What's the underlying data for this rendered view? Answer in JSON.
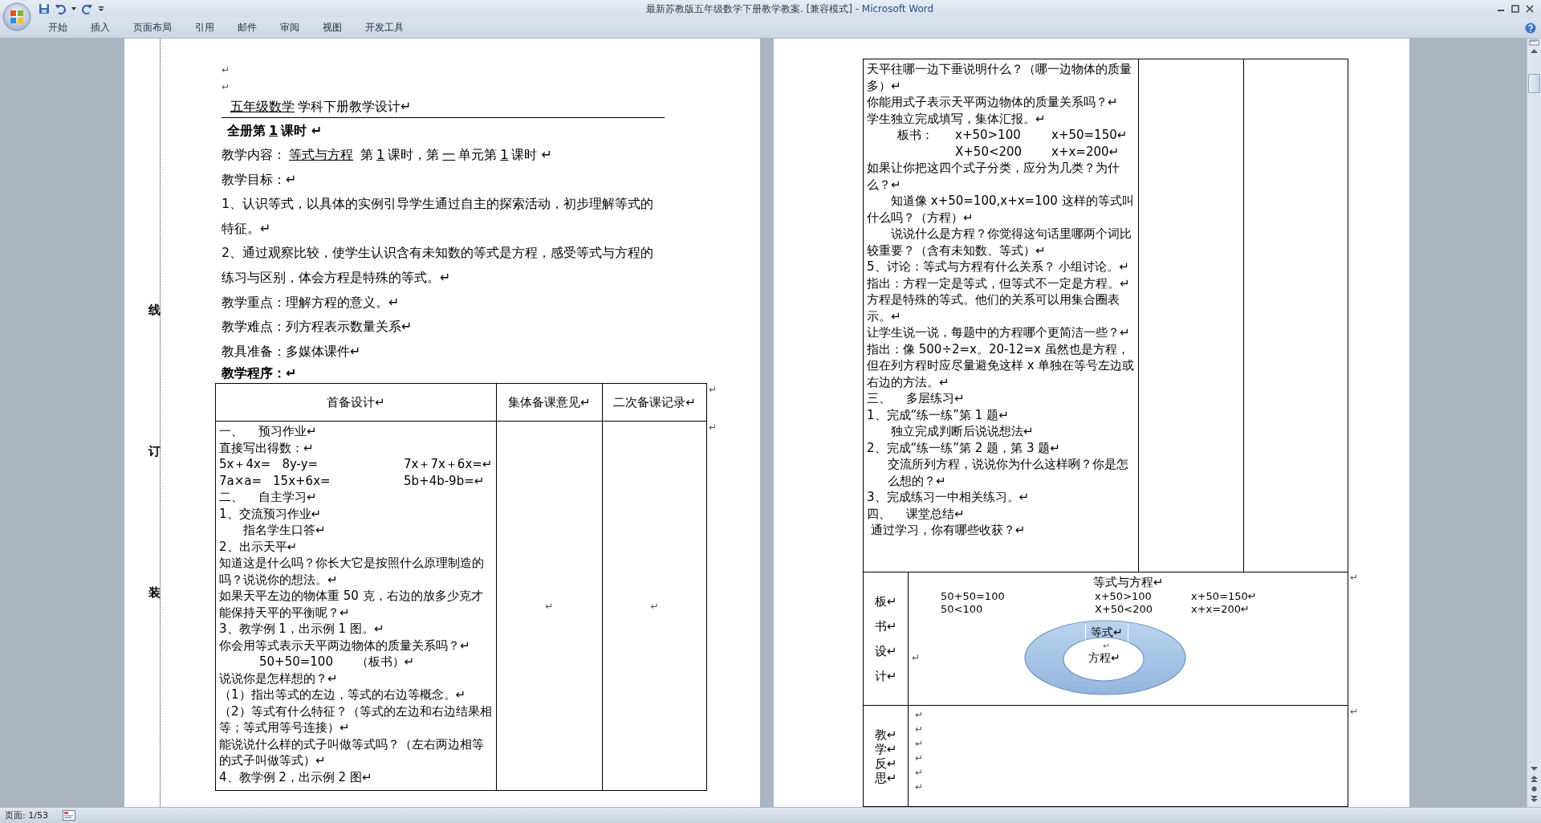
{
  "window": {
    "title": "最新苏教版五年级数学下册教学教案. [兼容模式]",
    "separator": "-",
    "app_name": "Microsoft Word"
  },
  "ribbon_tabs": [
    {
      "label": "开始",
      "selected": false
    },
    {
      "label": "插入",
      "selected": false
    },
    {
      "label": "页面布局",
      "selected": false
    },
    {
      "label": "引用",
      "selected": false
    },
    {
      "label": "邮件",
      "selected": false
    },
    {
      "label": "审阅",
      "selected": false
    },
    {
      "label": "视图",
      "selected": false
    },
    {
      "label": "开发工具",
      "selected": false
    }
  ],
  "left_page": {
    "gutter_marks": [
      "线",
      "订",
      "装"
    ],
    "blank_lines": [
      "↵",
      "↵"
    ],
    "heading": [
      {
        "text": "五年级数学",
        "underlined": true
      },
      {
        "text": "学科下册教学设计↵",
        "underlined": false
      }
    ],
    "lesson": [
      {
        "text": "全册第",
        "underlined": false
      },
      {
        "text": "1",
        "underlined": true
      },
      {
        "text": "课时 ↵",
        "underlined": false
      }
    ],
    "content_line": [
      {
        "text": "教学内容：",
        "underlined": false
      },
      {
        "text": "等式与方程",
        "underlined": true
      },
      {
        "text": " 第",
        "underlined": false
      },
      {
        "text": "1",
        "underlined": true
      },
      {
        "text": "课时，第",
        "underlined": false
      },
      {
        "text": "一",
        "underlined": true
      },
      {
        "text": "单元第",
        "underlined": false
      },
      {
        "text": "1",
        "underlined": true
      },
      {
        "text": "课时 ↵",
        "underlined": false
      }
    ],
    "paragraphs": [
      {
        "text": "教学目标：↵",
        "bold": false
      },
      {
        "text": "1、认识等式，以具体的实例引导学生通过自主的探索活动，初步理解等式的特征。↵",
        "bold": false
      },
      {
        "text": "2、通过观察比较，使学生认识含有未知数的等式是方程，感受等式与方程的练习与区别，体会方程是特殊的等式。↵",
        "bold": false
      },
      {
        "text": "教学重点：理解方程的意义。↵",
        "bold": false
      },
      {
        "text": "教学难点：列方程表示数量关系↵",
        "bold": false
      },
      {
        "text": "教具准备：多媒体课件↵",
        "bold": false
      },
      {
        "text": "教学程序：↵",
        "bold": true
      }
    ],
    "table": {
      "headers": [
        "首备设计↵",
        "集体备课意见↵",
        "二次备课记录↵"
      ],
      "header_end_mark": "↵",
      "lines": [
        {
          "kind": "text",
          "text": "一、    预习作业↵"
        },
        {
          "kind": "text",
          "text": "直接写出得数：↵"
        },
        {
          "kind": "formula",
          "cells": [
            "5x＋4x=",
            "8y-y=",
            "7x＋7x＋6x=↵"
          ]
        },
        {
          "kind": "formula",
          "cells": [
            "7a×a=",
            "15x+6x=",
            "5b+4b-9b=↵"
          ]
        },
        {
          "kind": "text",
          "text": "二、    自主学习↵"
        },
        {
          "kind": "text",
          "text": "1、交流预习作业↵"
        },
        {
          "kind": "first_indent",
          "text": "指名学生口答↵"
        },
        {
          "kind": "text",
          "text": "2、出示天平↵"
        },
        {
          "kind": "text",
          "text": "知道这是什么吗？你长大它是按照什么原理制造的吗？说说你的想法。↵"
        },
        {
          "kind": "text",
          "text": "如果天平左边的物体重 50 克，右边的放多少克才能保持天平的平衡呢？↵"
        },
        {
          "kind": "text",
          "text": "3、教学例 1，出示例 1 图。↵"
        },
        {
          "kind": "text",
          "text": "你会用等式表示天平两边物体的质量关系吗？↵"
        },
        {
          "kind": "deep_indent",
          "text": "50+50=100      （板书）↵"
        },
        {
          "kind": "text",
          "text": "说说你是怎样想的？↵"
        },
        {
          "kind": "text",
          "text": "（1）指出等式的左边，等式的右边等概念。↵"
        },
        {
          "kind": "text",
          "text": "（2）等式有什么特征？（等式的左边和右边结果相等；等式用等号连接）↵"
        },
        {
          "kind": "text",
          "text": "能说说什么样的式子叫做等式吗？（左右两边相等的式子叫做等式）↵"
        },
        {
          "kind": "text",
          "text": "4、教学例 2，出示例 2 图↵"
        }
      ],
      "column_2": "↵",
      "column_3": "↵",
      "body_end_mark": "↵"
    }
  },
  "right_page": {
    "table": {
      "lines": [
        {
          "kind": "text",
          "text": "天平往哪一边下垂说明什么？（哪一边物体的质量多）↵"
        },
        {
          "kind": "text",
          "text": "你能用式子表示天平两边物体的质量关系吗？↵"
        },
        {
          "kind": "text",
          "text": "学生独立完成填写，集体汇报。↵"
        },
        {
          "kind": "board",
          "cells": [
            "板书：",
            "x+50>100",
            "x+50=150↵"
          ]
        },
        {
          "kind": "board",
          "cells": [
            "X+50<200",
            "x+x=200↵"
          ]
        },
        {
          "kind": "text",
          "text": "如果让你把这四个式子分类，应分为几类？为什么？↵"
        },
        {
          "kind": "first_indent",
          "text": "知道像 x+50=100,x+x=100 这样的等式叫什么吗？（方程）↵"
        },
        {
          "kind": "first_indent",
          "text": "说说什么是方程？你觉得这句话里哪两个词比较重要？（含有未知数、等式）↵"
        },
        {
          "kind": "text",
          "text": "5、讨论：等式与方程有什么关系？ 小组讨论。↵"
        },
        {
          "kind": "text",
          "text": "指出：方程一定是等式，但等式不一定是方程。↵"
        },
        {
          "kind": "text",
          "text": "方程是特殊的等式。他们的关系可以用集合圈表示。↵"
        },
        {
          "kind": "text",
          "text": "让学生说一说，每题中的方程哪个更简洁一些？↵"
        },
        {
          "kind": "text",
          "text": "指出：像 500÷2=x。20-12=x 虽然也是方程，但在列方程时应尽量避免这样 x 单独在等号左边或右边的方法。↵"
        },
        {
          "kind": "text",
          "text": "三、    多层练习↵"
        },
        {
          "kind": "text",
          "text": "1、完成“练一练”第 1 题↵"
        },
        {
          "kind": "first_indent",
          "text": "独立完成判断后说说想法↵"
        },
        {
          "kind": "text",
          "text": "2、完成“练一练”第 2 题，第 3 题↵"
        },
        {
          "kind": "hanging",
          "text": "交流所列方程，说说你为什么这样咧？你是怎么想的？↵"
        },
        {
          "kind": "text",
          "text": "3、完成练习一中相关练习。↵"
        },
        {
          "kind": "text",
          "text": "四、    课堂总结↵"
        },
        {
          "kind": "text",
          "text": " 通过学习，你有哪些收获？↵"
        }
      ]
    },
    "board_row": {
      "label": [
        "板↵",
        "书↵",
        "设↵",
        "计↵"
      ],
      "title": "等式与方程↵",
      "formula_columns": [
        [
          "50+50=100",
          "50<100"
        ],
        [
          "x+50>100",
          "X+50<200"
        ],
        [
          "x+50=150↵",
          "x+x=200↵"
        ]
      ],
      "side_mark": "↵",
      "diagram": {
        "outer_label": "等式↵",
        "gap_mark": "↵",
        "inner_label": "方程↵"
      },
      "end_mark": "↵"
    },
    "reflection_row": {
      "label": [
        "教↵",
        "学↵",
        "反↵",
        "思↵"
      ],
      "lines": [
        "↵",
        "↵",
        "↵",
        "↵",
        "↵",
        "↵"
      ],
      "end_mark": "↵"
    }
  },
  "status_bar": {
    "page": "页面: 1/53"
  }
}
